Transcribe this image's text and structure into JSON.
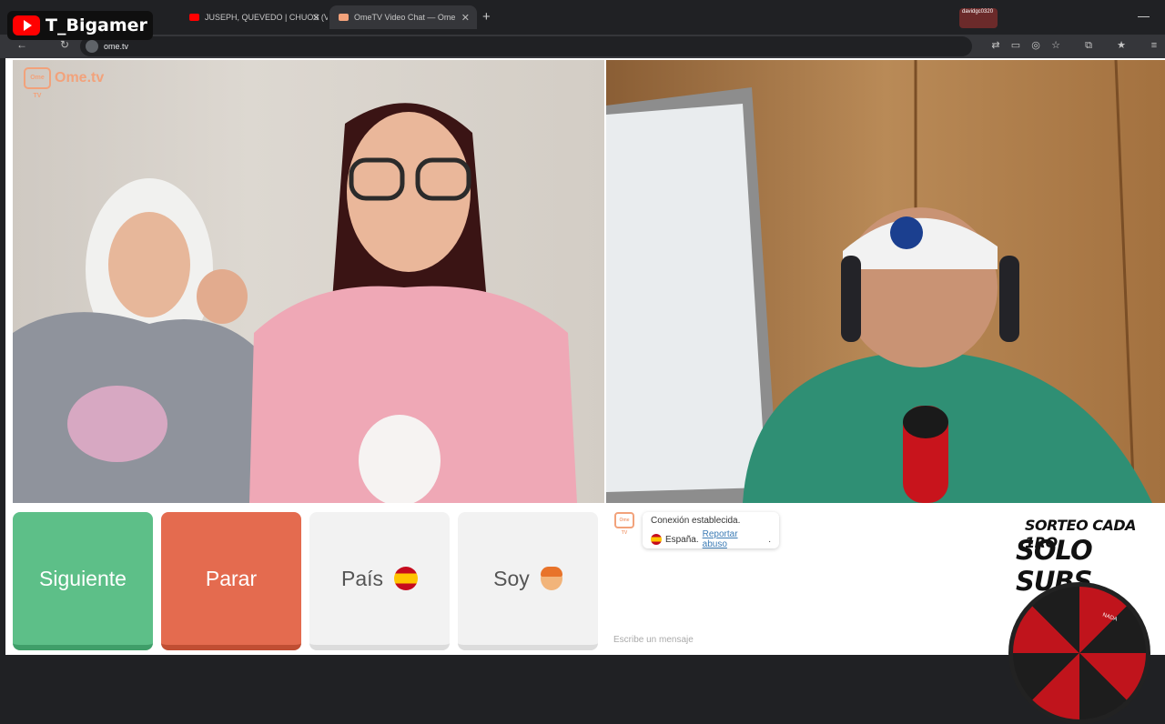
{
  "browser": {
    "tabs": [
      {
        "title": "JUSEPH, QUEVEDO | CHUOS (V...",
        "active": false
      },
      {
        "title": "OmeTV Video Chat — Ome",
        "active": true
      }
    ],
    "url": "ome.tv",
    "profile": "davidgc0320"
  },
  "channel": {
    "name": "T_Bigamer"
  },
  "ometv": {
    "logo_badge": "Ome TV",
    "logo_text": "Ome.tv"
  },
  "controls": {
    "next_label": "Siguiente",
    "stop_label": "Parar",
    "country_label": "País",
    "me_label": "Soy"
  },
  "chat": {
    "status": "Conexión establecida.",
    "country": "España.",
    "report_link": "Reportar abuso",
    "report_suffix": ".",
    "placeholder": "Escribe un mensaje"
  },
  "promo": {
    "line1": "SORTEO CADA 1RO",
    "line2": "SOLO SUBS",
    "wheel_slice": "NADA"
  },
  "colors": {
    "next": "#5dbf88",
    "stop": "#e46b4f",
    "brand": "#f2a27b",
    "youtube": "#ff0000"
  }
}
